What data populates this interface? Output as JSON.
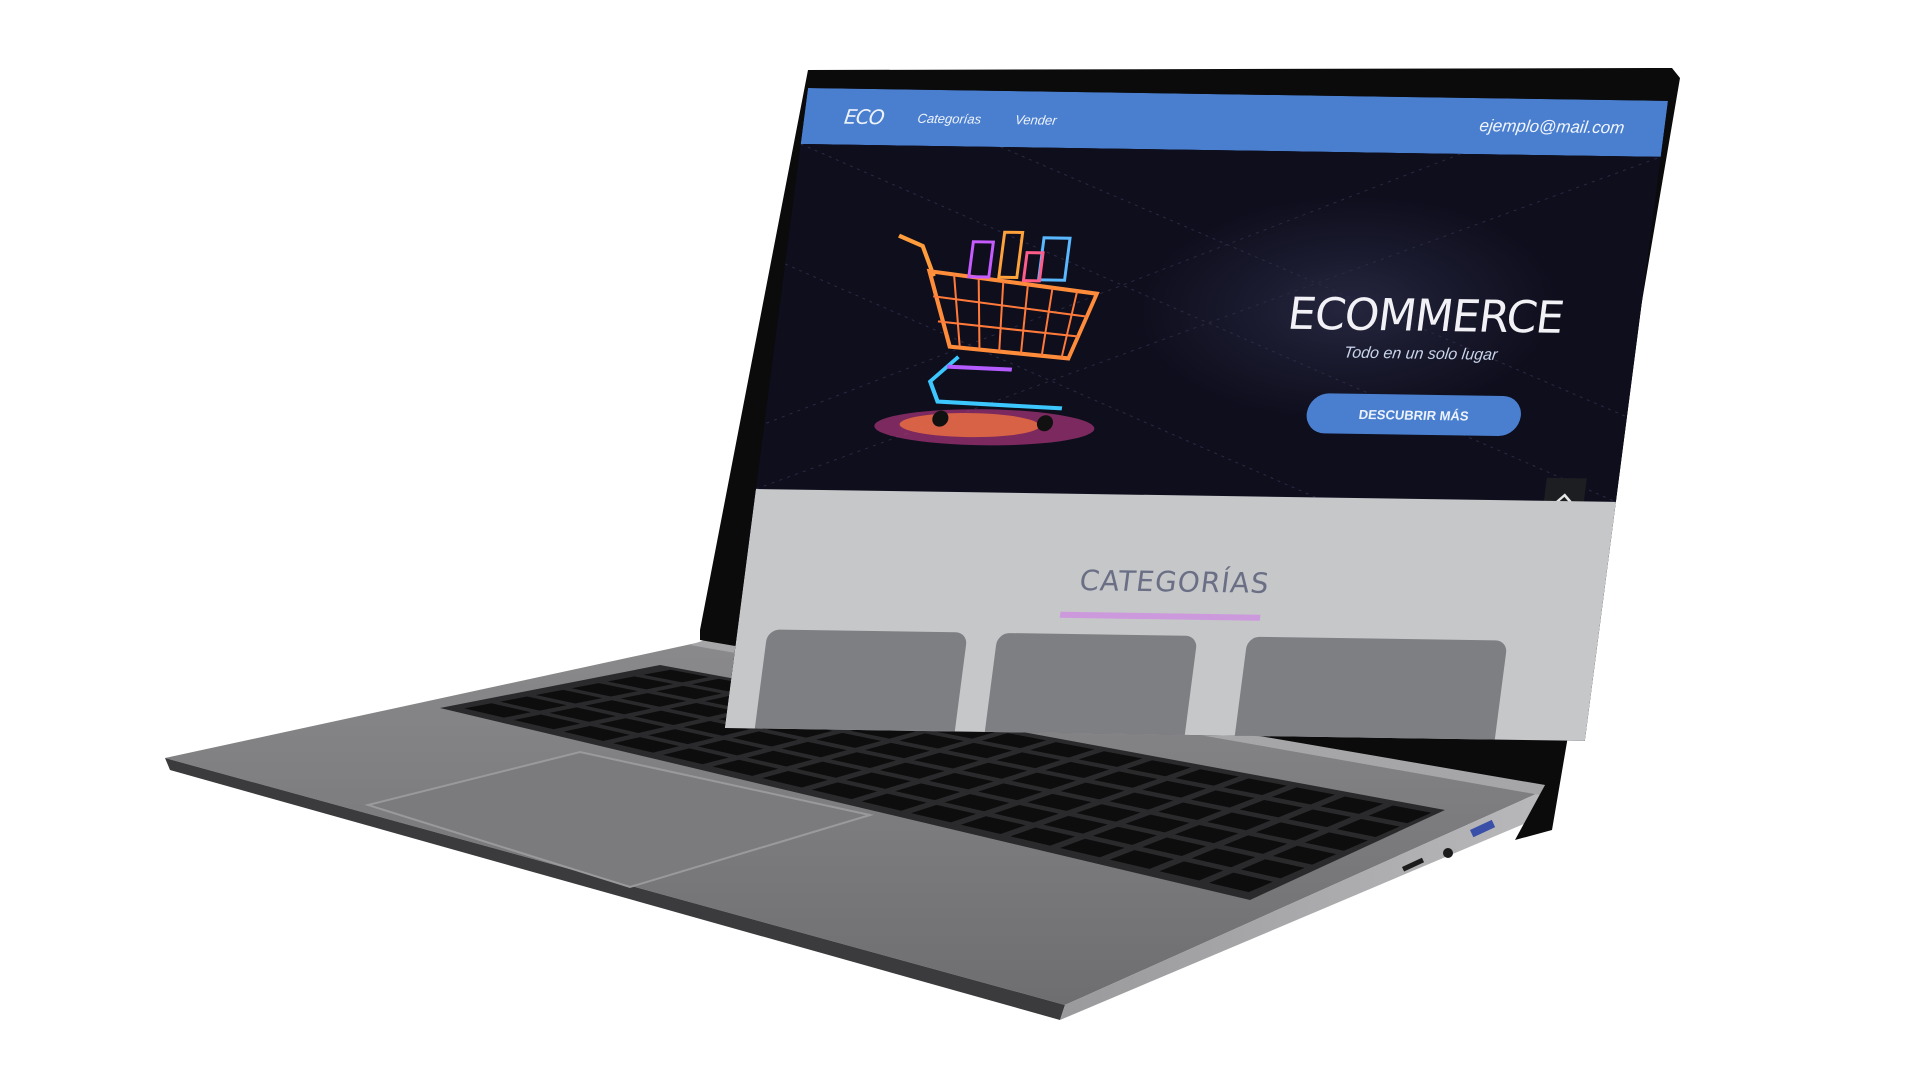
{
  "nav": {
    "logo": "ECO",
    "links": [
      "Categorías",
      "Vender"
    ],
    "email": "ejemplo@mail.com"
  },
  "hero": {
    "title": "ECOMMERCE",
    "subtitle": "Todo en un solo lugar",
    "button_label": "DESCUBRIR MÁS",
    "image_icon": "shopping-cart-icon",
    "scroll_top_icon": "chevron-up-icon"
  },
  "categories": {
    "title": "CATEGORÍAS",
    "card_count_visible": 3
  },
  "colors": {
    "nav_bg": "#4a7fd0",
    "hero_bg": "#0d0d1c",
    "button_bg": "#4a7fd0",
    "categories_bg": "#c6c7c9",
    "underline": "#cc99dd"
  }
}
